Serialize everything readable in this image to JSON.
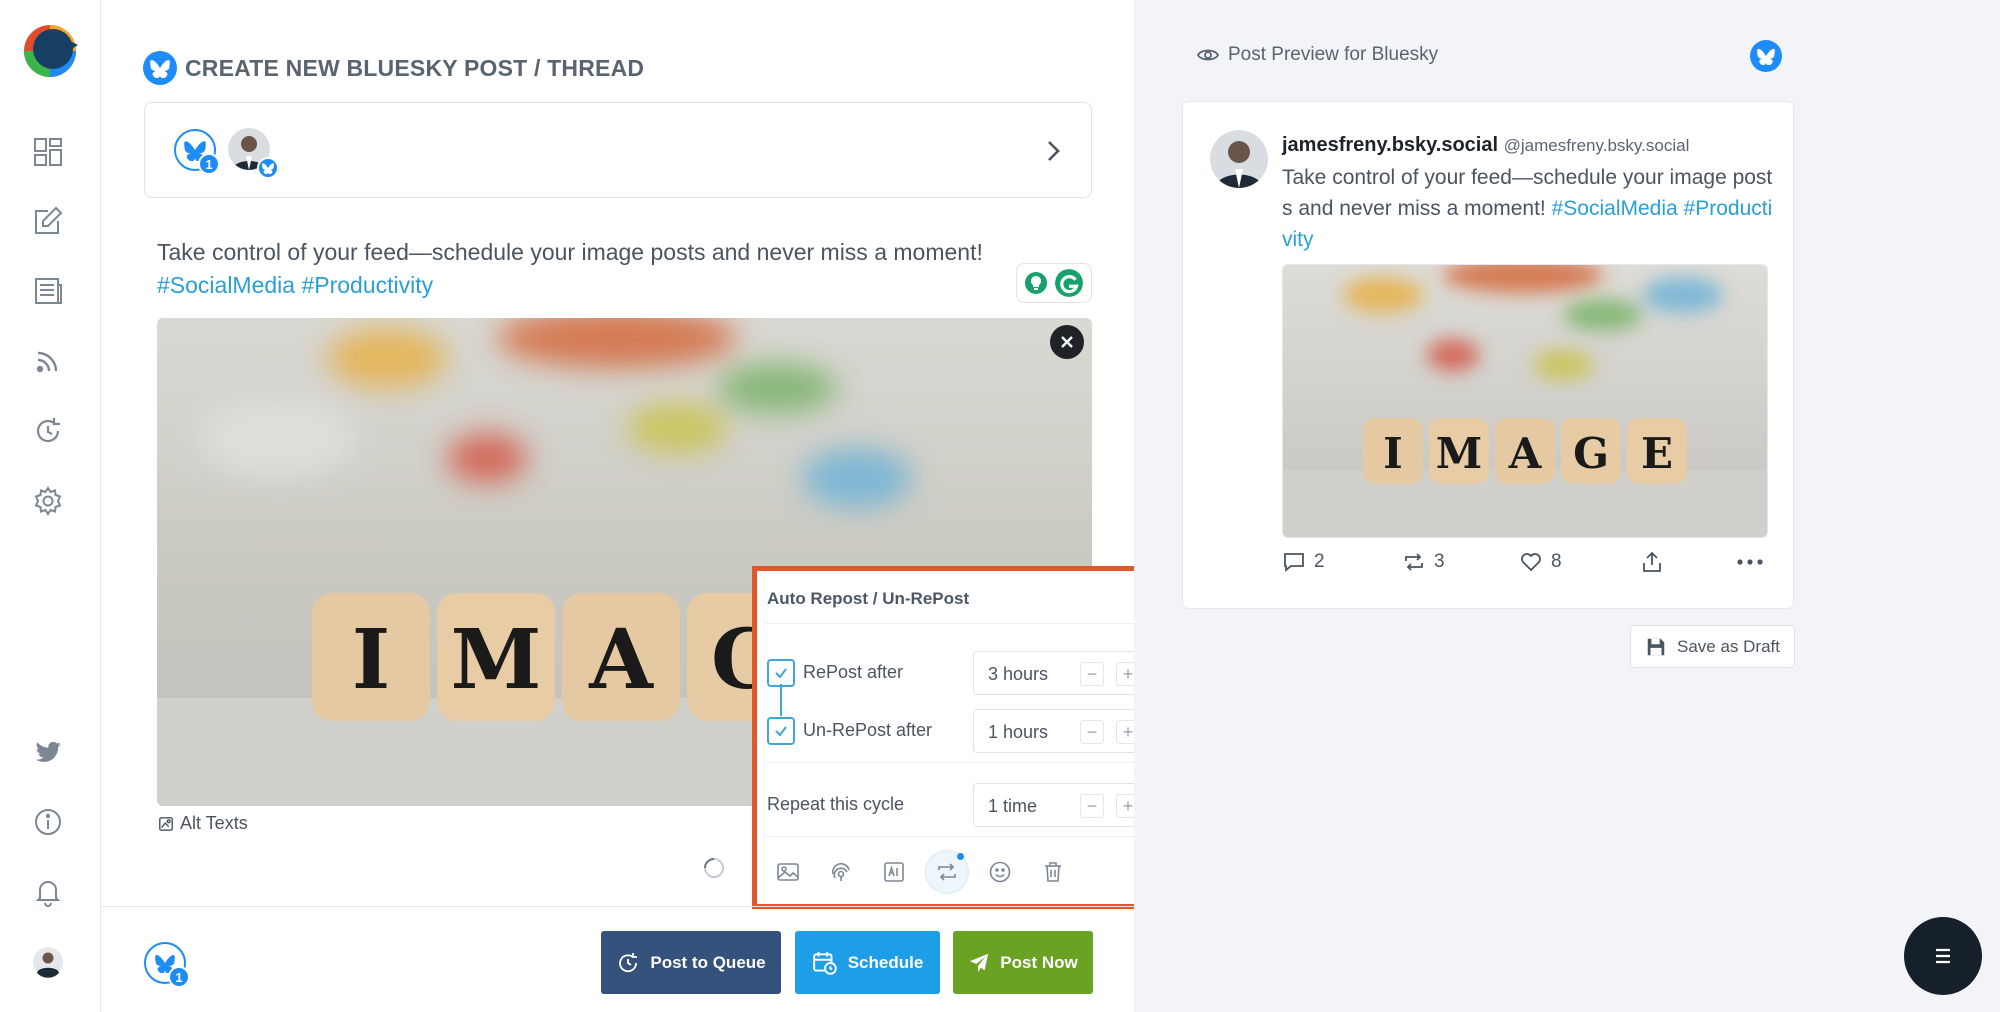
{
  "composer": {
    "title": "CREATE NEW BLUESKY POST / THREAD",
    "account_badge_count": "1",
    "post_text_main": "Take control of your feed—schedule your image posts and never miss a moment!",
    "post_text_tags": "#SocialMedia #Productivity",
    "alt_texts_label": "Alt Texts",
    "image_word": "IMAGE"
  },
  "auto_repost": {
    "title": "Auto Repost / Un-RePost",
    "repost_label": "RePost after",
    "repost_value": "3 hours",
    "unrepost_label": "Un-RePost after",
    "unrepost_value": "1 hours",
    "repeat_label": "Repeat this cycle",
    "repeat_value": "1 time",
    "minus": "−",
    "plus": "+"
  },
  "footer": {
    "account_badge_count": "1",
    "queue_label": "Post to Queue",
    "schedule_label": "Schedule",
    "post_now_label": "Post Now",
    "colors": {
      "queue": "#34527c",
      "schedule": "#1d9ee6",
      "post_now": "#6aa324"
    }
  },
  "preview": {
    "header": "Post Preview for Bluesky",
    "display_name": "jamesfreny.bsky.social",
    "handle": "@jamesfreny.bsky.social",
    "text_main": "Take control of your feed—schedule your image posts and never miss a moment!",
    "text_tags": "#SocialMedia #Productivity",
    "replies": "2",
    "reposts": "3",
    "likes": "8",
    "save_draft_label": "Save as Draft"
  },
  "icons": {
    "sidebar": [
      "dashboard-icon",
      "compose-icon",
      "posts-icon",
      "rss-icon",
      "recycle-icon",
      "settings-icon",
      "twitter-icon",
      "info-icon",
      "bell-icon",
      "user-avatar"
    ],
    "toolbar": [
      "loading-icon",
      "add-thread-icon",
      "image-icon",
      "ai-spark-icon",
      "ai-text-icon",
      "repost-icon",
      "emoji-icon",
      "trash-icon"
    ]
  },
  "brand_color": "#1d8cf8",
  "highlight_color": "#e0572a"
}
